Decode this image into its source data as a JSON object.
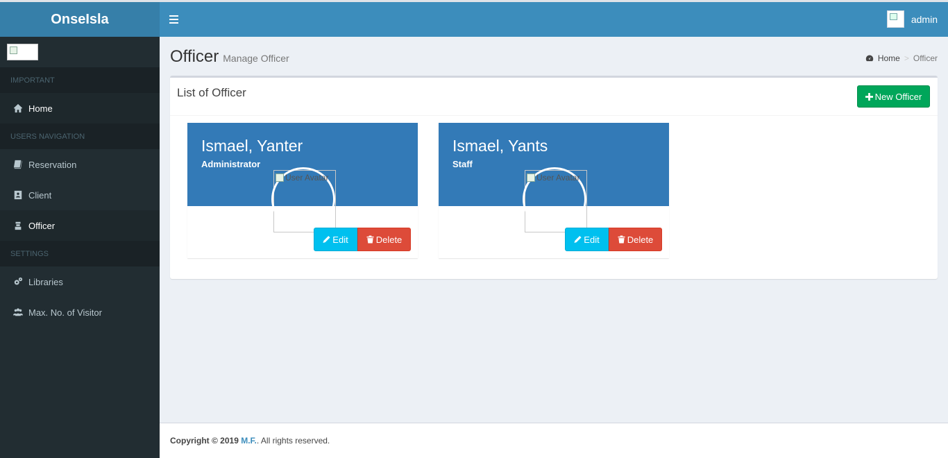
{
  "app": {
    "logo_text": "OnseIsla"
  },
  "navbar": {
    "username": "admin"
  },
  "sidebar": {
    "headers": [
      "IMPORTANT",
      "USERS NAVIGATION",
      "SETTINGS"
    ],
    "items": [
      {
        "label": "Home",
        "icon": "home-icon"
      },
      {
        "label": "Reservation",
        "icon": "book-icon"
      },
      {
        "label": "Client",
        "icon": "contact-book-icon"
      },
      {
        "label": "Officer",
        "icon": "officer-icon"
      },
      {
        "label": "Libraries",
        "icon": "gears-icon"
      },
      {
        "label": "Max. No. of Visitor",
        "icon": "users-icon"
      }
    ]
  },
  "page": {
    "title": "Officer",
    "subtitle": "Manage Officer",
    "breadcrumb": {
      "home": "Home",
      "current": "Officer"
    }
  },
  "box": {
    "title": "List of Officer",
    "new_button": "New Officer"
  },
  "officers": [
    {
      "name": "Ismael, Yanter",
      "role": "Administrator",
      "avatar_alt": "User Avatar",
      "edit_label": "Edit",
      "delete_label": "Delete"
    },
    {
      "name": "Ismael, Yants",
      "role": "Staff",
      "avatar_alt": "User Avatar",
      "edit_label": "Edit",
      "delete_label": "Delete"
    }
  ],
  "footer": {
    "prefix": "Copyright © 2019",
    "brand": "M.F.",
    "suffix": ". All rights reserved."
  },
  "colors": {
    "primary": "#3c8dbc",
    "sidebar_bg": "#222d32",
    "card_head": "#337ab7",
    "success": "#00a65a",
    "info": "#00c0ef",
    "danger": "#dd4b39"
  }
}
